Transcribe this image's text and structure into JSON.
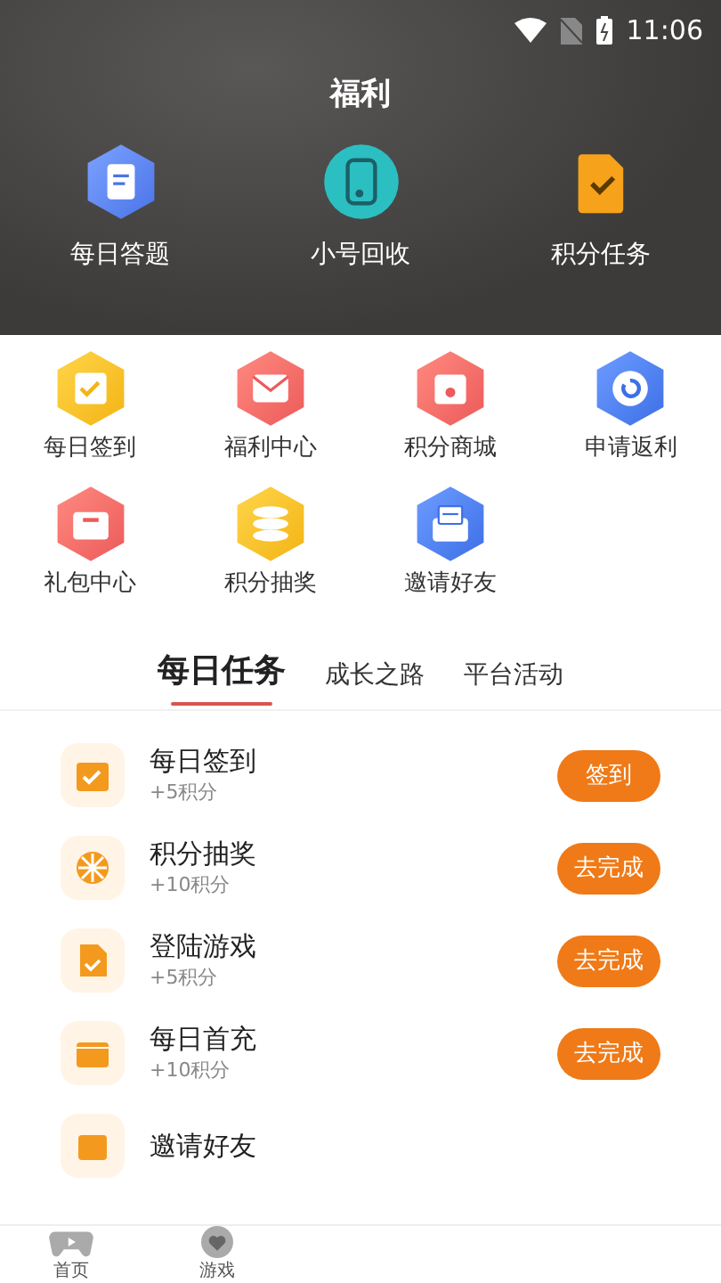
{
  "status_bar": {
    "time": "11:06"
  },
  "header": {
    "title": "福利",
    "shortcuts": [
      {
        "label": "每日答题"
      },
      {
        "label": "小号回收"
      },
      {
        "label": "积分任务"
      }
    ]
  },
  "grid": [
    {
      "label": "每日签到"
    },
    {
      "label": "福利中心"
    },
    {
      "label": "积分商城"
    },
    {
      "label": "申请返利"
    },
    {
      "label": "礼包中心"
    },
    {
      "label": "积分抽奖"
    },
    {
      "label": "邀请好友"
    }
  ],
  "tabs": [
    {
      "label": "每日任务",
      "selected": true
    },
    {
      "label": "成长之路",
      "selected": false
    },
    {
      "label": "平台活动",
      "selected": false
    }
  ],
  "tasks": [
    {
      "title": "每日签到",
      "points": "+5积分",
      "action": "签到"
    },
    {
      "title": "积分抽奖",
      "points": "+10积分",
      "action": "去完成"
    },
    {
      "title": "登陆游戏",
      "points": "+5积分",
      "action": "去完成"
    },
    {
      "title": "每日首充",
      "points": "+10积分",
      "action": "去完成"
    },
    {
      "title": "邀请好友"
    }
  ],
  "bottom_nav": [
    {
      "label": "首页",
      "selected": false
    },
    {
      "label": "游戏",
      "selected": false
    }
  ]
}
